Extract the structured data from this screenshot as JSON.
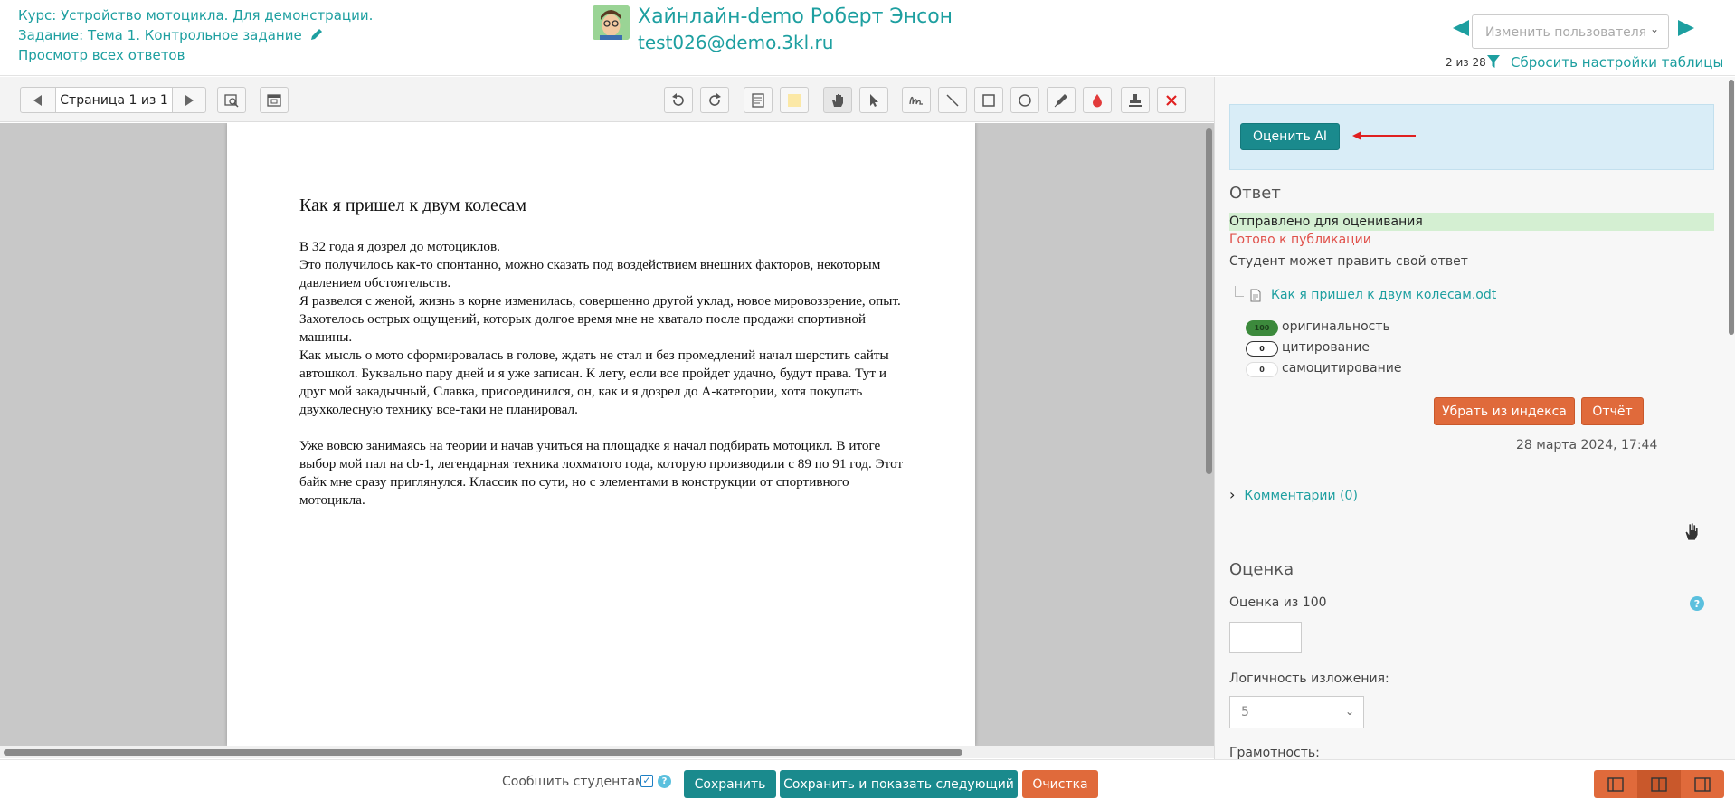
{
  "header": {
    "course": "Курс: Устройство мотоцикла. Для демонстрации.",
    "assignment": "Задание: Тема 1. Контрольное задание",
    "view_all": "Просмотр всех ответов",
    "user_name": "Хайнлайн-demo Роберт Энсон",
    "user_email": "test026@demo.3kl.ru",
    "user_select_placeholder": "Изменить пользователя",
    "count": "2 из 28",
    "reset_table": "Сбросить настройки таблицы"
  },
  "toolbar": {
    "page_label": "Страница 1 из 1"
  },
  "document": {
    "title": "Как я пришел к двум колесам",
    "p1": "В 32  года я дозрел до мотоциклов.",
    "p2": "Это получилось как-то спонтанно, можно сказать под воздействием внешних факторов, некоторым давлением обстоятельств.",
    "p3": "Я развелся с женой, жизнь в корне изменилась, совершенно другой уклад, новое мировоззрение, опыт. Захотелось острых ощущений, которых долгое время мне не хватало после продажи спортивной машины.",
    "p4": "Как мысль о мото сформировалась в голове, ждать не стал и без промедлений начал шерстить сайты автошкол. Буквально пару дней и я уже записан. К лету, если все пройдет удачно, будут права. Тут и друг мой закадычный, Славка, присоединился, он, как и я дозрел до А-категории, хотя покупать двухколесную технику все-таки не планировал.",
    "p5": "Уже вовсю занимаясь на теории и начав учиться на площадке я начал подбирать мотоцикл. В итоге выбор мой пал на cb-1, легендарная техника лохматого года, которую производили с 89 по 91 год. Этот байк мне сразу приглянулся. Классик по сути, но с элементами в конструкции от спортивного мотоцикла."
  },
  "panel": {
    "ai_button": "Оценить AI",
    "answer_title": "Ответ",
    "status_sent": "Отправлено для оценивания",
    "status_ready": "Готово к публикации",
    "status_edit": "Студент может править свой ответ",
    "file_name": "Как я пришел к двум колесам.odt",
    "originality_value": "100",
    "originality_label": "оригинальность",
    "citation_value": "0",
    "citation_label": "цитирование",
    "selfcitation_value": "0",
    "selfcitation_label": "самоцитирование",
    "remove_index": "Убрать из индекса",
    "report": "Отчёт",
    "date": "28 марта 2024, 17:44",
    "comments": "Комментарии (0)",
    "grade_title": "Оценка",
    "grade_label": "Оценка из 100",
    "help": "?",
    "logic_label": "Логичность изложения:",
    "logic_value": "5",
    "literacy_label": "Грамотность:"
  },
  "footer": {
    "notify_label": "Сообщить студентам",
    "save": "Сохранить",
    "save_next": "Сохранить и показать следующий",
    "clear": "Очистка",
    "help": "?"
  },
  "colors": {
    "accent": "#1d9fa0",
    "primary_button": "#1a8a8d",
    "danger": "#e06a3b",
    "success_bg": "#d4efd2",
    "info_bg": "#d9edf7"
  }
}
